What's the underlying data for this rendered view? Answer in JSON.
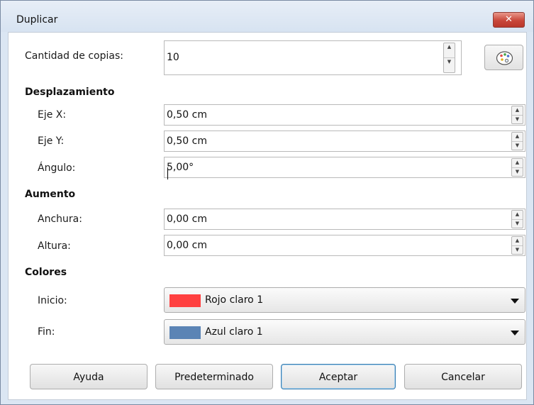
{
  "window": {
    "title": "Duplicar",
    "close_label": "✕"
  },
  "copies": {
    "label": "Cantidad de copias:",
    "value": "10"
  },
  "offset": {
    "heading": "Desplazamiento",
    "x_label": "Eje X:",
    "x_value": "0,50 cm",
    "y_label": "Eje Y:",
    "y_value": "0,50 cm",
    "angle_label": "Ángulo:",
    "angle_value": "5,00°"
  },
  "enlargement": {
    "heading": "Aumento",
    "width_label": "Anchura:",
    "width_value": "0,00 cm",
    "height_label": "Altura:",
    "height_value": "0,00 cm"
  },
  "colors": {
    "heading": "Colores",
    "start_label": "Inicio:",
    "start_value": "Rojo claro 1",
    "start_color": "#ff4040",
    "end_label": "Fin:",
    "end_value": "Azul claro 1",
    "end_color": "#5b84b5"
  },
  "buttons": {
    "help": "Ayuda",
    "default": "Predeterminado",
    "ok": "Aceptar",
    "cancel": "Cancelar"
  },
  "icons": {
    "palette": "palette-icon",
    "spin_up": "▲",
    "spin_down": "▼"
  }
}
